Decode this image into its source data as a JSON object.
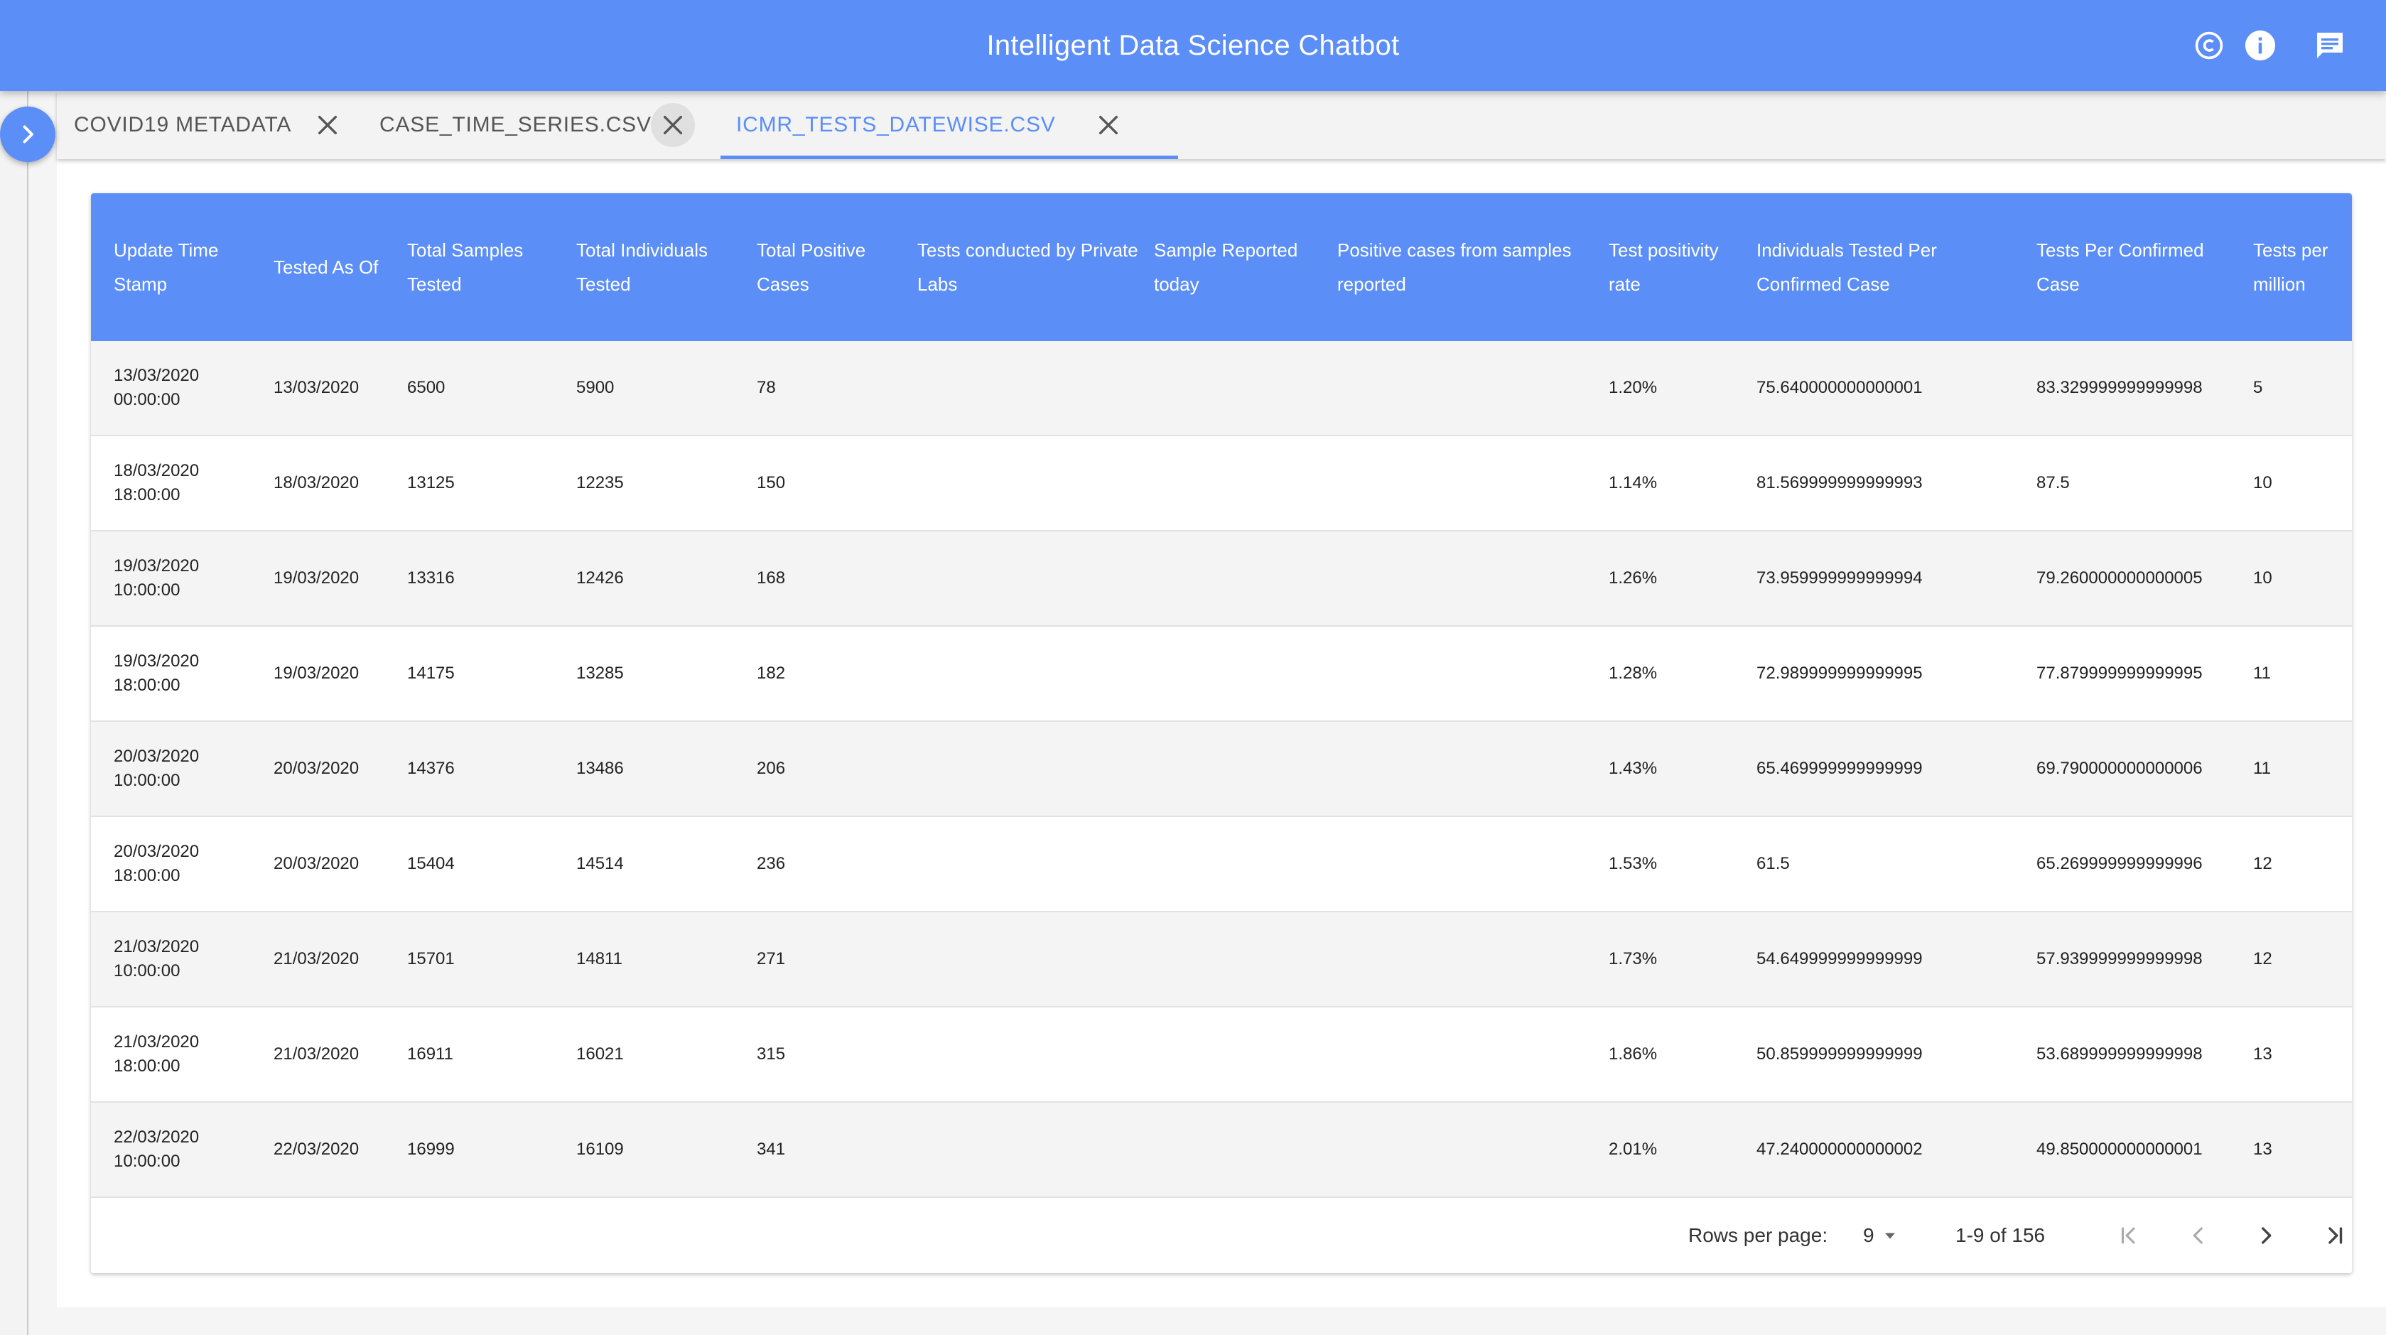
{
  "app": {
    "title": "Intelligent Data Science Chatbot",
    "accent": "#5b8ef7",
    "icons": [
      "copyright-icon",
      "info-icon",
      "chat-icon"
    ]
  },
  "tabs": [
    {
      "label": "COVID19 METADATA",
      "active": false
    },
    {
      "label": "CASE_TIME_SERIES.CSV",
      "active": false
    },
    {
      "label": "ICMR_TESTS_DATEWISE.CSV",
      "active": true
    }
  ],
  "table": {
    "columns": [
      "Update Time Stamp",
      "Tested As Of",
      "Total Samples Tested",
      "Total Individuals Tested",
      "Total Positive Cases",
      "Tests conducted by Private Labs",
      "Sample Reported today",
      "Positive cases from samples reported",
      "Test positivity rate",
      "Individuals Tested Per Confirmed Case",
      "Tests Per Confirmed Case",
      "Tests per million"
    ],
    "rows": [
      [
        "13/03/2020\n00:00:00",
        "13/03/2020",
        "6500",
        "5900",
        "78",
        "",
        "",
        "",
        "1.20%",
        "75.640000000000001",
        "83.329999999999998",
        "5"
      ],
      [
        "18/03/2020\n18:00:00",
        "18/03/2020",
        "13125",
        "12235",
        "150",
        "",
        "",
        "",
        "1.14%",
        "81.569999999999993",
        "87.5",
        "10"
      ],
      [
        "19/03/2020\n10:00:00",
        "19/03/2020",
        "13316",
        "12426",
        "168",
        "",
        "",
        "",
        "1.26%",
        "73.959999999999994",
        "79.260000000000005",
        "10"
      ],
      [
        "19/03/2020\n18:00:00",
        "19/03/2020",
        "14175",
        "13285",
        "182",
        "",
        "",
        "",
        "1.28%",
        "72.989999999999995",
        "77.879999999999995",
        "11"
      ],
      [
        "20/03/2020\n10:00:00",
        "20/03/2020",
        "14376",
        "13486",
        "206",
        "",
        "",
        "",
        "1.43%",
        "65.469999999999999",
        "69.790000000000006",
        "11"
      ],
      [
        "20/03/2020\n18:00:00",
        "20/03/2020",
        "15404",
        "14514",
        "236",
        "",
        "",
        "",
        "1.53%",
        "61.5",
        "65.269999999999996",
        "12"
      ],
      [
        "21/03/2020\n10:00:00",
        "21/03/2020",
        "15701",
        "14811",
        "271",
        "",
        "",
        "",
        "1.73%",
        "54.649999999999999",
        "57.939999999999998",
        "12"
      ],
      [
        "21/03/2020\n18:00:00",
        "21/03/2020",
        "16911",
        "16021",
        "315",
        "",
        "",
        "",
        "1.86%",
        "50.859999999999999",
        "53.689999999999998",
        "13"
      ],
      [
        "22/03/2020\n10:00:00",
        "22/03/2020",
        "16999",
        "16109",
        "341",
        "",
        "",
        "",
        "2.01%",
        "47.240000000000002",
        "49.850000000000001",
        "13"
      ]
    ]
  },
  "pagination": {
    "rows_per_page_label": "Rows per page:",
    "rows_per_page": "9",
    "range": "1-9 of 156"
  }
}
